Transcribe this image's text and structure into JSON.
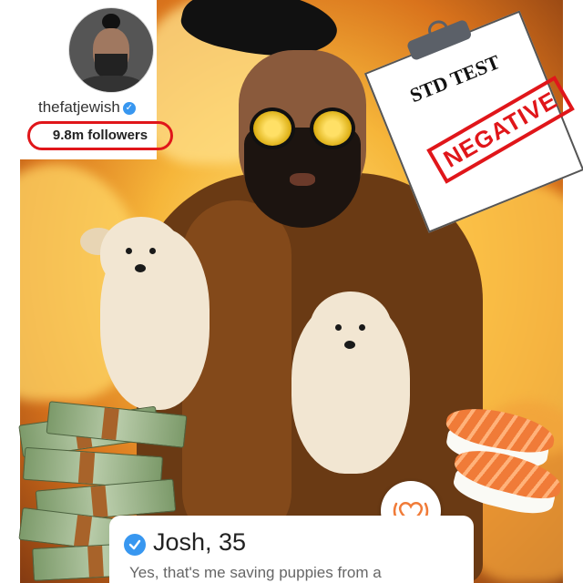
{
  "profile": {
    "username": "thefatjewish",
    "followers": "9.8m followers"
  },
  "clipboard": {
    "title": "STD TEST",
    "stamp": "NEGATIVE"
  },
  "card": {
    "name_age": "Josh, 35",
    "bio": "Yes, that's me saving puppies from a"
  },
  "colors": {
    "highlight_ring": "#e0161a",
    "verified_blue": "#3897f0",
    "like_orange": "#f07b38"
  },
  "icons": {
    "verified": "verified-check-icon",
    "like": "heart-icon"
  }
}
